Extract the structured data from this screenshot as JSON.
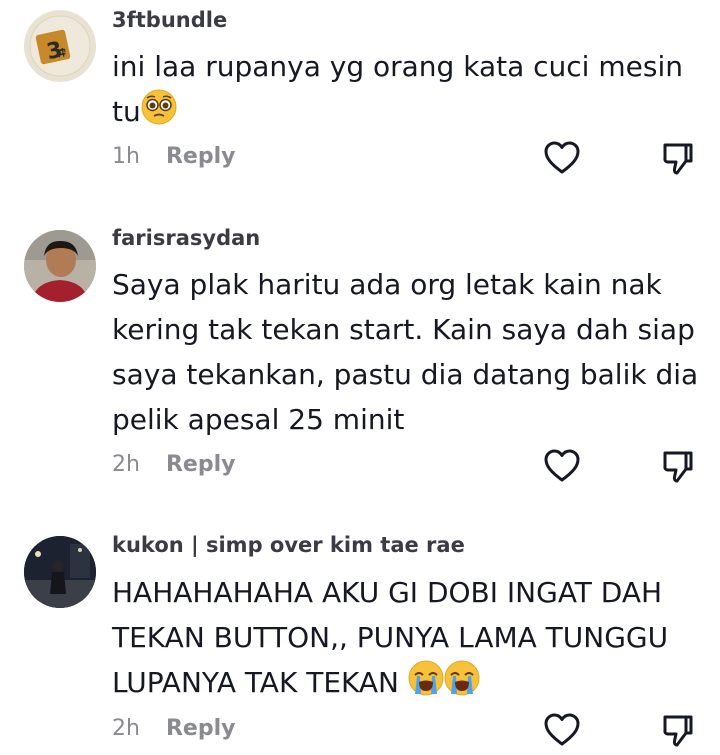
{
  "comments": [
    {
      "username": "3ftbundle",
      "text": "ini laa rupanya yg orang kata cuci mesin tu",
      "time": "1h",
      "reply_label": "Reply",
      "avatar_logo_text": "3ft",
      "emoji": [
        "pleading-face"
      ]
    },
    {
      "username": "farisrasydan",
      "text": "Saya plak haritu ada org letak kain nak kering tak tekan start. Kain saya dah siap saya tekankan, pastu dia datang balik dia pelik apesal 25 minit",
      "time": "2h",
      "reply_label": "Reply"
    },
    {
      "username": "kukon | simp over kim tae rae",
      "text": "HAHAHAHAHA AKU GI DOBI INGAT DAH TEKAN BUTTON,, PUNYA LAMA TUNGGU LUPANYA TAK TEKAN",
      "time": "2h",
      "reply_label": "Reply",
      "emoji": [
        "loudly-crying-face",
        "loudly-crying-face"
      ]
    }
  ],
  "icons": {
    "like": "heart-outline-icon",
    "dislike": "thumbs-down-outline-icon"
  },
  "colors": {
    "text": "#161823",
    "username": "#3b3b45",
    "meta": "#8a8b91",
    "icon_stroke": "#161823"
  }
}
